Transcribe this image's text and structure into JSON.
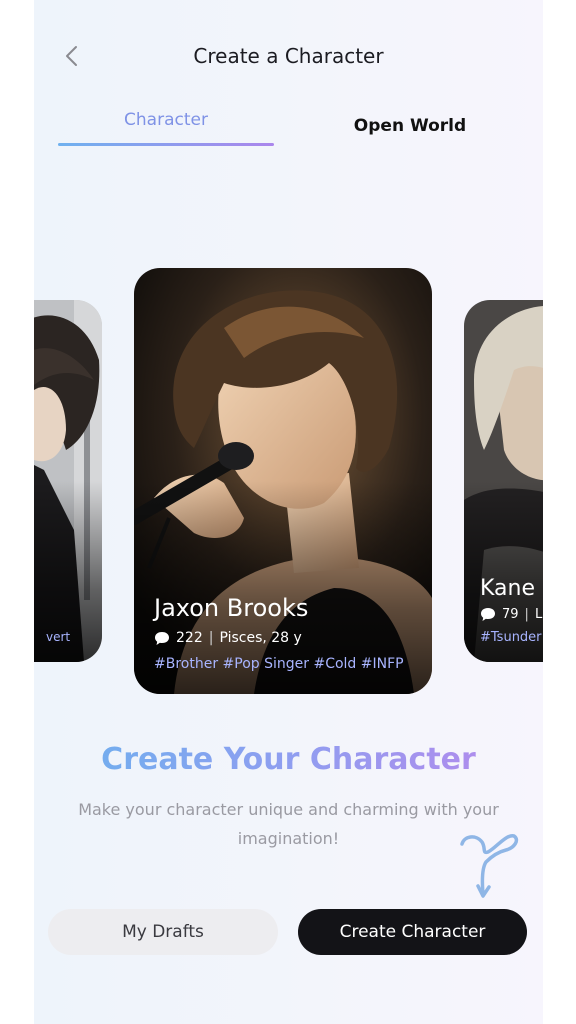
{
  "header": {
    "title": "Create a Character"
  },
  "tabs": [
    {
      "label": "Character",
      "active": true
    },
    {
      "label": "Open World",
      "active": false
    }
  ],
  "cards": {
    "left": {
      "tag_fragment": "vert"
    },
    "main": {
      "name": "Jaxon Brooks",
      "chats": "222",
      "separator": "|",
      "details": "Pisces, 28 y",
      "tags": "#Brother #Pop Singer #Cold #INFP"
    },
    "right": {
      "name": "Kane",
      "chats": "79",
      "separator": "|",
      "details": "L",
      "tags": "#Tsunder"
    }
  },
  "headline": "Create Your Character",
  "subtitle": "Make your character unique and charming with your imagination!",
  "buttons": {
    "drafts": "My Drafts",
    "create": "Create Character"
  },
  "colors": {
    "accent_blue": "#6bb2ee",
    "accent_purple": "#b888ec",
    "tag_color": "#a8b4ff",
    "primary_button": "#131317"
  },
  "icons": [
    "back-chevron-icon",
    "chat-bubble-icon",
    "swirl-arrow-icon"
  ]
}
